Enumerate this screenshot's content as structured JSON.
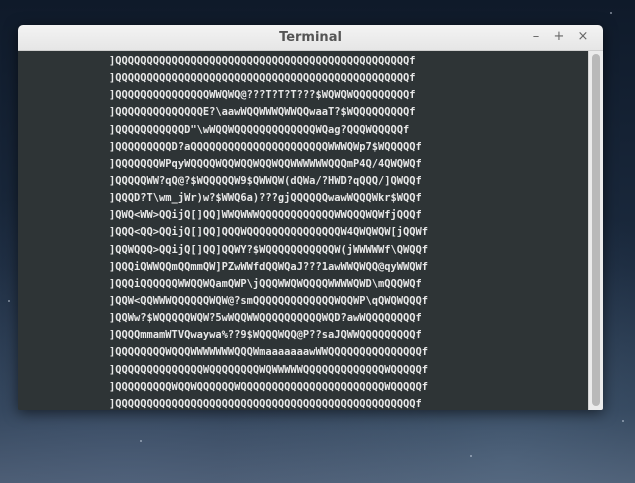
{
  "window": {
    "title": "Terminal",
    "minimize_glyph": "–",
    "maximize_glyph": "+",
    "close_glyph": "×"
  },
  "terminal": {
    "lines": [
      "]QQQQQQQQQQQQQQQQQQQQQQQQQQQQQQQQQQQQQQQQQQQQQQQf",
      "]QQQQQQQQQQQQQQQQQQQQQQQQQQQQQQQQQQQQQQQQQQQQQQQf",
      "]QQQQQQQQQQQQQQQWWQWQ@???T?T?T???$WQWQWQQQQQQQQQf",
      "]QQQQQQQQQQQQQQE?\\aawWQQWWWQWWQQwaaT?$WQQQQQQQQQf",
      "]QQQQQQQQQQQD\"\\wWQQWQQQQQQQQQQQQQWQag?QQQWQQQQQf",
      "]QQQQQQQQQD?aQQQQQQQQQQQQQQQQQQQQQQWWWQWp7$WQQQQQf",
      "]QQQQQQQWPqyWQQQQWQQWQQWQQWQQWWWWWWQQQmP4Q/4QWQWQf",
      "]QQQQQWW?qQ@?$WQQQQQW9$QWWQW(dQWa/?HWD?qQQQ/]QWQQf",
      "]QQQD?T\\wm_jWr)w?$WWQ6a)???gjQQQQQQwawWQQQWkr$WQQf",
      "]QWQ<WW>QQijQ[]QQ]WWQWWWQQQQQQQQQQQQWWQQQWQWfjQQQf",
      "]QQQ<QQ>QQijQ[]QQ]QQQWQQQQQQQQQQQQQQQW4QWQWQW[jQQWf",
      "]QQWQQQ>QQijQ[]QQ]QQWY?$WQQQQQQQQQQQW(jWWWWWf\\QWQQf",
      "]QQQiQWWQQmQQmmQW]PZwWWfdQQWQaJ???1awWWQWQQ@qyWWQWf",
      "]QQQiQQQQQQWWQQWQamQWP\\jQQQWWQWQQQQWWWWQWD\\mQQQWQf",
      "]QQW<QQWWWQQQQQQWQW@?smQQQQQQQQQQQQQWQQWP\\qQWQWQQQf",
      "]QQWw?$WQQQQQWQW?5wWQQWWQQQQQQQQQQWQD?awWQQQQQQQQf",
      "]QQQQmmamWTVQwaywa%??9$WQQQWQQ@P??saJQWWQQQQQQQQQf",
      "]QQQQQQQQWQQQWWWWWWWQQQWmaaaaaaawWWQQQQQQQQQQQQQQQf",
      "]QQQQQQQQQQQQQQWQQQQQQQQWQWWWWWQQQQQQQQQQQQQWQQQQQf",
      "]QQQQQQQQQWQQWQQQQQQWQQQQQQQQQQQQQQQQQQQQQQQWQQQQQf",
      "]QQQQQQQQQQQQQQQQQQQQQQQQQQQQQQQQQQQQQQQQQQQQQQQQf"
    ]
  },
  "colors": {
    "terminal_bg": "#2e3436",
    "terminal_fg": "#e8e8e8",
    "titlebar_bg": "#ececec"
  }
}
